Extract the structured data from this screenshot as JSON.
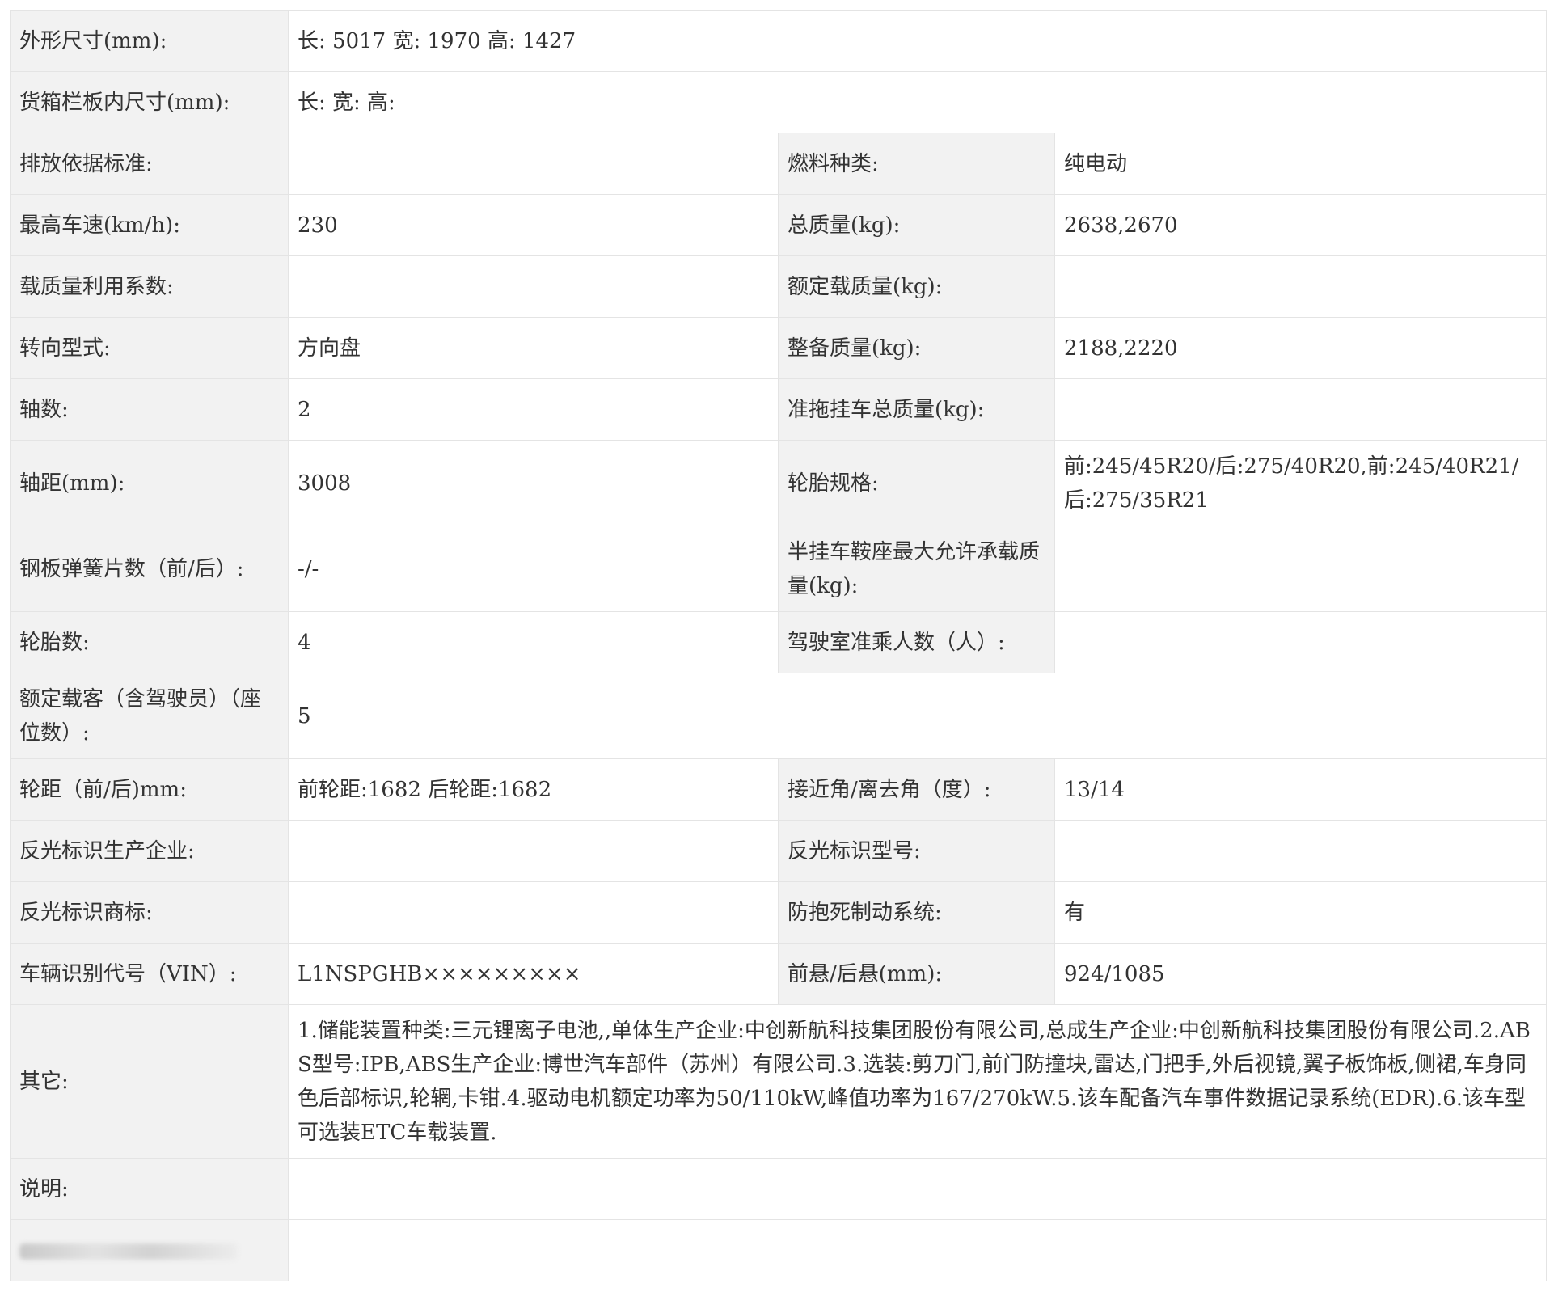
{
  "rows": [
    {
      "label": "外形尺寸(mm):",
      "value": "长: 5017 宽: 1970 高: 1427"
    },
    {
      "label": "货箱栏板内尺寸(mm):",
      "value": "长: 宽: 高:"
    },
    {
      "label": "排放依据标准:",
      "value": "",
      "label2": "燃料种类:",
      "value2": "纯电动"
    },
    {
      "label": "最高车速(km/h):",
      "value": "230",
      "label2": "总质量(kg):",
      "value2": "2638,2670"
    },
    {
      "label": "载质量利用系数:",
      "value": "",
      "label2": "额定载质量(kg):",
      "value2": ""
    },
    {
      "label": "转向型式:",
      "value": "方向盘",
      "label2": "整备质量(kg):",
      "value2": "2188,2220"
    },
    {
      "label": "轴数:",
      "value": "2",
      "label2": "准拖挂车总质量(kg):",
      "value2": ""
    },
    {
      "label": "轴距(mm):",
      "value": "3008",
      "label2": "轮胎规格:",
      "value2": "前:245/45R20/后:275/40R20,前:245/40R21/后:275/35R21"
    },
    {
      "label": "钢板弹簧片数（前/后）:",
      "value": "-/-",
      "label2": "半挂车鞍座最大允许承载质量(kg):",
      "value2": ""
    },
    {
      "label": "轮胎数:",
      "value": "4",
      "label2": "驾驶室准乘人数（人）:",
      "value2": ""
    },
    {
      "label": "额定载客（含驾驶员）（座位数）:",
      "value": "5"
    },
    {
      "label": "轮距（前/后)mm:",
      "value": "前轮距:1682 后轮距:1682",
      "label2": "接近角/离去角（度）:",
      "value2": "13/14"
    },
    {
      "label": "反光标识生产企业:",
      "value": "",
      "label2": "反光标识型号:",
      "value2": ""
    },
    {
      "label": "反光标识商标:",
      "value": "",
      "label2": "防抱死制动系统:",
      "value2": "有"
    },
    {
      "label": "车辆识别代号（VIN）:",
      "value": "L1NSPGHB×××××××××",
      "label2": "前悬/后悬(mm):",
      "value2": "924/1085"
    },
    {
      "label": "其它:",
      "value": "1.储能装置种类:三元锂离子电池,,单体生产企业:中创新航科技集团股份有限公司,总成生产企业:中创新航科技集团股份有限公司.2.ABS型号:IPB,ABS生产企业:博世汽车部件（苏州）有限公司.3.选装:剪刀门,前门防撞块,雷达,门把手,外后视镜,翼子板饰板,侧裙,车身同色后部标识,轮辋,卡钳.4.驱动电机额定功率为50/110kW,峰值功率为167/270kW.5.该车配备汽车事件数据记录系统(EDR).6.该车型可选装ETC车载装置."
    },
    {
      "label": "说明:",
      "value": ""
    }
  ]
}
